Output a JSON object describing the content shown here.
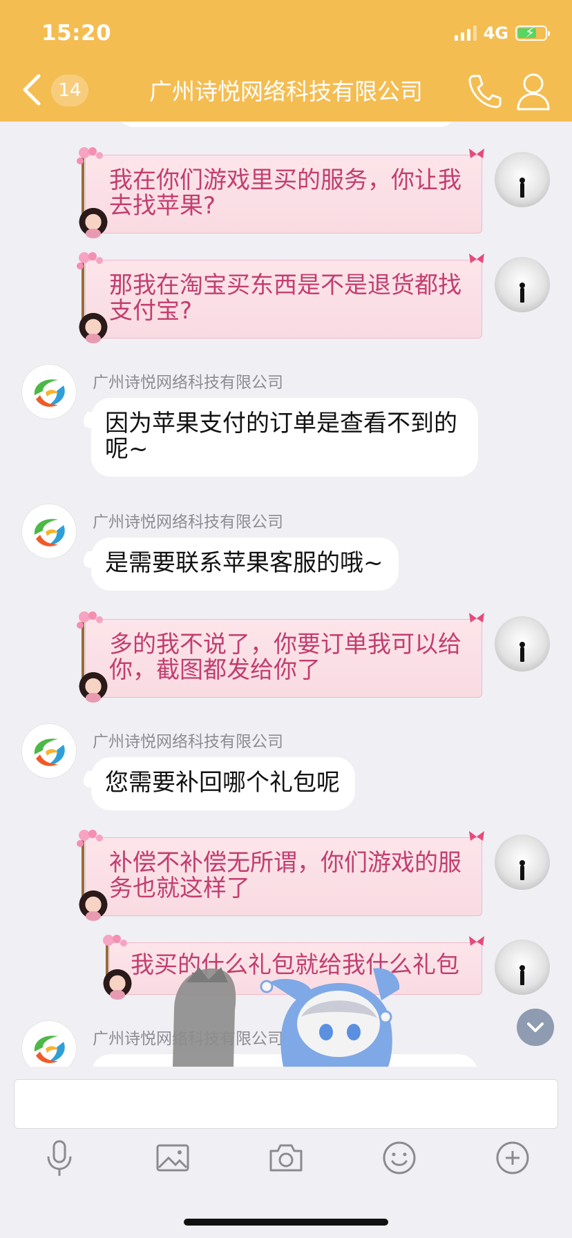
{
  "status_bar": {
    "time": "15:20",
    "network": "4G"
  },
  "header": {
    "unread_count": "14",
    "title": "广州诗悦网络科技有限公司"
  },
  "messages": [
    {
      "side": "out",
      "text": "我在你们游戏里买的服务，你让我去找苹果?"
    },
    {
      "side": "out",
      "text": "那我在淘宝买东西是不是退货都找支付宝?"
    },
    {
      "side": "in",
      "sender": "广州诗悦网络科技有限公司",
      "text": "因为苹果支付的订单是查看不到的呢~"
    },
    {
      "side": "in",
      "sender": "广州诗悦网络科技有限公司",
      "text": "是需要联系苹果客服的哦~"
    },
    {
      "side": "out",
      "text": "多的我不说了，你要订单我可以给你，截图都发给你了"
    },
    {
      "side": "in",
      "sender": "广州诗悦网络科技有限公司",
      "text": "您需要补回哪个礼包呢"
    },
    {
      "side": "out",
      "text": "补偿不补偿无所谓，你们游戏的服务也就这样了"
    },
    {
      "side": "out",
      "text": "我买的什么礼包就给我什么礼包"
    },
    {
      "side": "in",
      "sender": "广州诗悦网络科技有限公司",
      "text": ""
    }
  ],
  "input": {
    "value": ""
  },
  "toolbar": [
    "microphone-icon",
    "image-icon",
    "camera-icon",
    "emoji-icon",
    "plus-icon"
  ],
  "colors": {
    "header_bg": "#f4bd52",
    "chat_bg": "#efeff4",
    "out_bubble_bg": "#fce5ea",
    "out_text": "#c23e6f",
    "in_bubble_bg": "#ffffff"
  }
}
